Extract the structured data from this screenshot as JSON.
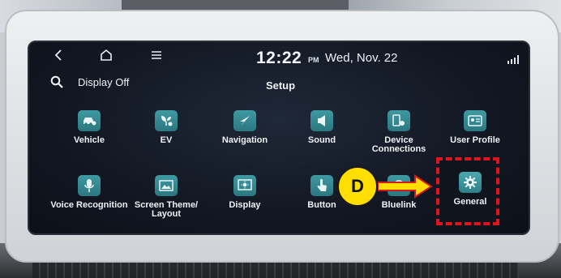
{
  "status_bar": {
    "back_icon": "chevron-left-icon",
    "home_icon": "home-icon",
    "menu_icon": "menu-icon",
    "time": "12:22",
    "ampm": "PM",
    "date": "Wed, Nov. 22",
    "signal_icon": "signal-icon"
  },
  "header": {
    "search_icon": "search-icon",
    "display_off_label": "Display Off",
    "title": "Setup"
  },
  "menu": {
    "items": [
      {
        "label": "Vehicle",
        "icon": "car-settings-icon"
      },
      {
        "label": "EV",
        "icon": "ev-plant-icon"
      },
      {
        "label": "Navigation",
        "icon": "navigation-arrow-icon"
      },
      {
        "label": "Sound",
        "icon": "speaker-icon"
      },
      {
        "label": "Device\nConnections",
        "icon": "device-connection-icon"
      },
      {
        "label": "User Profile",
        "icon": "user-profile-icon"
      },
      {
        "label": "Voice Recognition",
        "icon": "microphone-icon"
      },
      {
        "label": "Screen Theme/\nLayout",
        "icon": "picture-icon"
      },
      {
        "label": "Display",
        "icon": "display-brightness-icon"
      },
      {
        "label": "Button",
        "icon": "button-touch-icon"
      },
      {
        "label": "Bluelink",
        "icon": "bluelink-icon"
      },
      {
        "label": "General",
        "icon": "gear-icon"
      }
    ]
  },
  "annotation": {
    "marker_label": "D",
    "highlight_color": "#e0141c",
    "marker_color": "#ffde00"
  }
}
